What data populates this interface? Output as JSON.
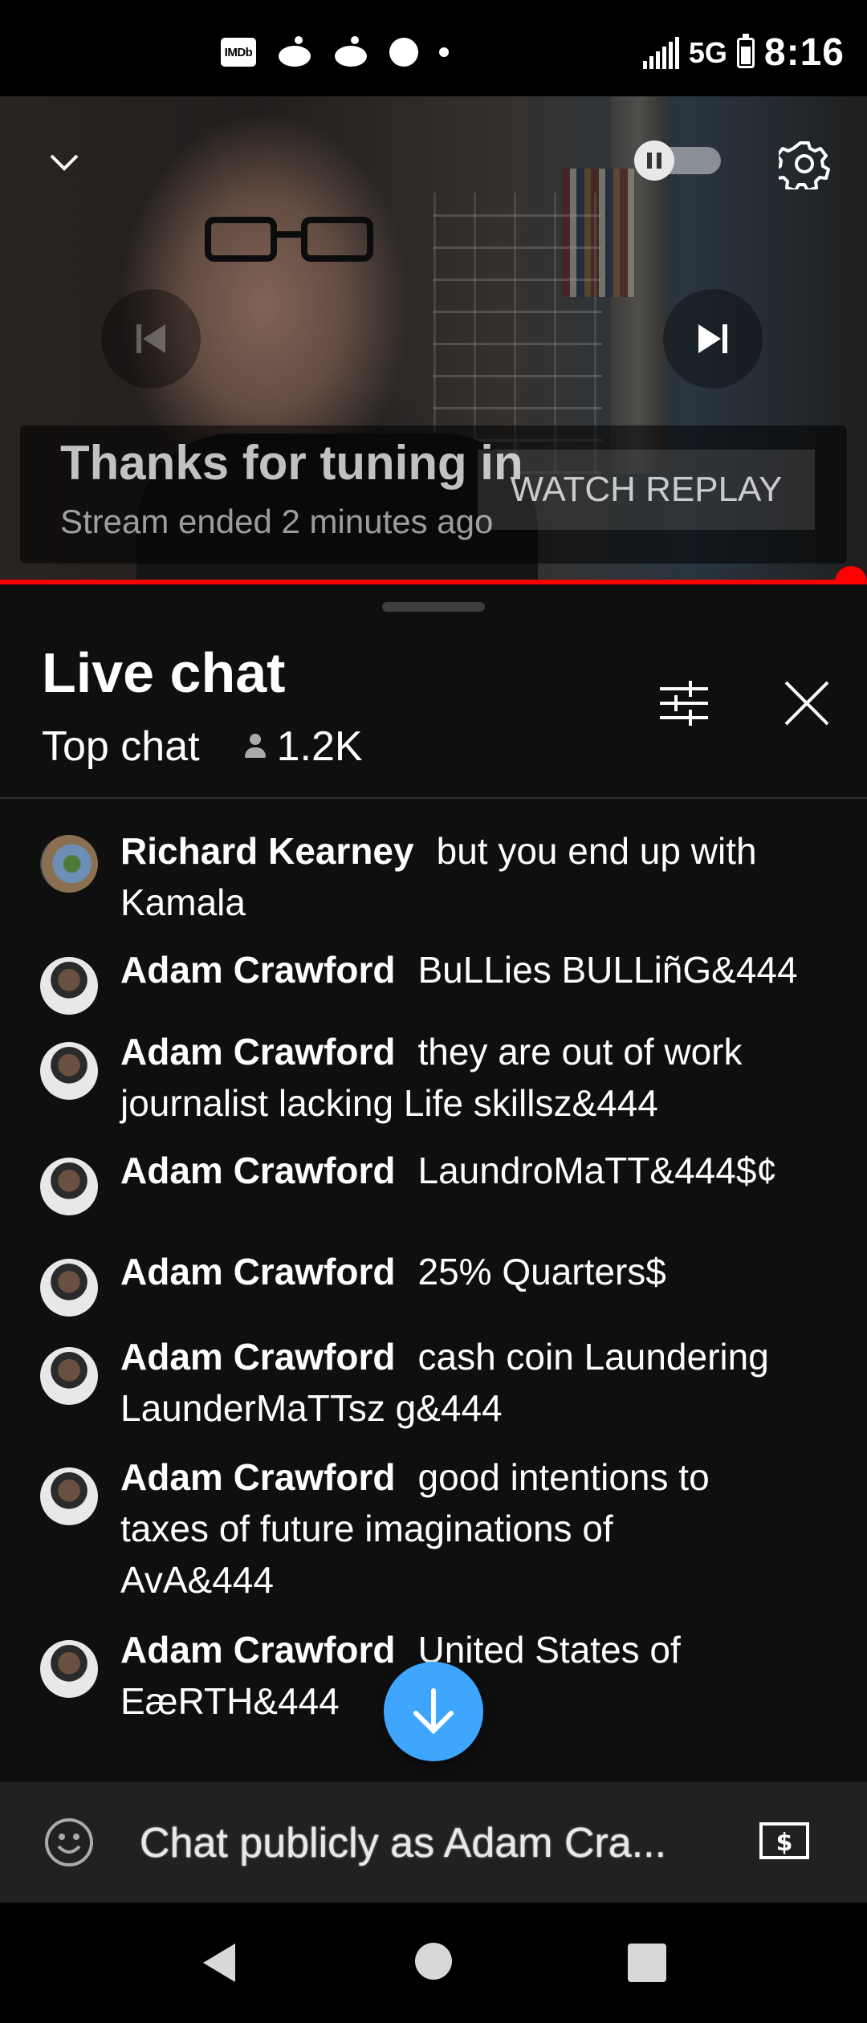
{
  "status_bar": {
    "imdb_label": "IMDb",
    "network": "5G",
    "battery_level": "7",
    "time": "8:16",
    "icons": [
      "imdb-icon",
      "reddit-icon",
      "reddit-icon",
      "dot-icon",
      "dot-icon",
      "signal-icon",
      "battery-icon"
    ]
  },
  "video": {
    "end_title": "Thanks for tuning in",
    "end_subtitle": "Stream ended 2 minutes ago",
    "replay_label": "WATCH REPLAY",
    "progress_fraction": 1.0,
    "accent_color": "#ff0000",
    "controls": [
      "chevron-down-icon",
      "autoplay-toggle",
      "gear-icon",
      "previous-icon",
      "next-icon",
      "fullscreen-icon"
    ]
  },
  "chat": {
    "title": "Live chat",
    "mode": "Top chat",
    "viewers": "1.2K",
    "messages": [
      {
        "author": "Richard Kearney",
        "text": "but you end up with Kamala"
      },
      {
        "author": "Adam Crawford",
        "text": "BuLLies BULLiñG&444"
      },
      {
        "author": "Adam Crawford",
        "text": "they are out of work journalist lacking Life skillsz&444"
      },
      {
        "author": "Adam Crawford",
        "text": "LaundroMaTT&444$¢"
      },
      {
        "author": "Adam Crawford",
        "text": "25% Quarters$"
      },
      {
        "author": "Adam Crawford",
        "text": "cash coin Laundering LaunderMaTTsz g&444"
      },
      {
        "author": "Adam Crawford",
        "text": "good intentions to taxes of future imaginations of AvA&444"
      },
      {
        "author": "Adam Crawford",
        "text": "United States of EæRTH&444"
      }
    ],
    "input_placeholder": "Chat publicly as Adam Cra...",
    "scroll_button_color": "#3ea6ff"
  }
}
